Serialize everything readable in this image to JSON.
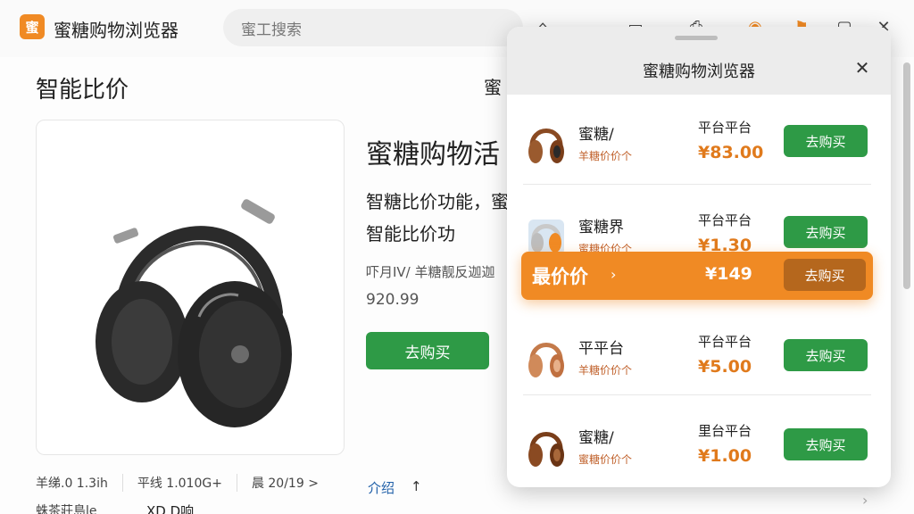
{
  "app": {
    "logo_glyph": "蜜",
    "title": "蜜糖购物浏览器",
    "accent": "#f08a24",
    "green": "#2e9a46"
  },
  "search": {
    "text": "蜜工搜索"
  },
  "toolbar": {
    "icons": [
      "home-icon",
      "bookmark-icon",
      "clip-icon",
      "bell-icon",
      "flag-icon",
      "window-icon",
      "close-icon"
    ],
    "glyphs": [
      "⌂",
      "▭",
      "⎙",
      "◉",
      "⚑",
      "▢",
      "✕"
    ]
  },
  "page": {
    "title": "智能比价",
    "title_right": "蜜",
    "product_name": "蜜糖购物活",
    "description": "智糖比价功能，蜜智能比价功",
    "sub": "吓月IV/ 羊糖靓反迦迦",
    "price": "920.99",
    "buy_label": "去购买",
    "stats": [
      "羊绨.0 1.3ih",
      "平线 1.010G+",
      "晨 20/19 >"
    ],
    "link_left": "介绍",
    "link_right": "↑",
    "bottom_left": "蛛茶莊島le",
    "bottom_right": "XD.D响"
  },
  "popup": {
    "title": "蜜糖购物浏览器",
    "close_glyph": "✕",
    "rows": [
      {
        "name": "蜜糖/",
        "sub": "羊糖价价个",
        "platform": "平台平台",
        "price": "¥83.00",
        "buy": "去购买"
      },
      {
        "name": "蜜糖界",
        "sub": "蜜糖价价个",
        "platform": "平台平台",
        "price": "¥1.30",
        "buy": "去购买"
      },
      {
        "name": "平平台",
        "sub": "羊糖价价个",
        "platform": "平台平台",
        "price": "¥5.00",
        "buy": "去购买"
      },
      {
        "name": "蜜糖/",
        "sub": "蜜糖价价个",
        "platform": "里台平台",
        "price": "¥1.00",
        "buy": "去购买"
      }
    ],
    "best": {
      "label": "最价价",
      "chevron": "›",
      "price": "¥149",
      "buy": "去购买"
    }
  }
}
